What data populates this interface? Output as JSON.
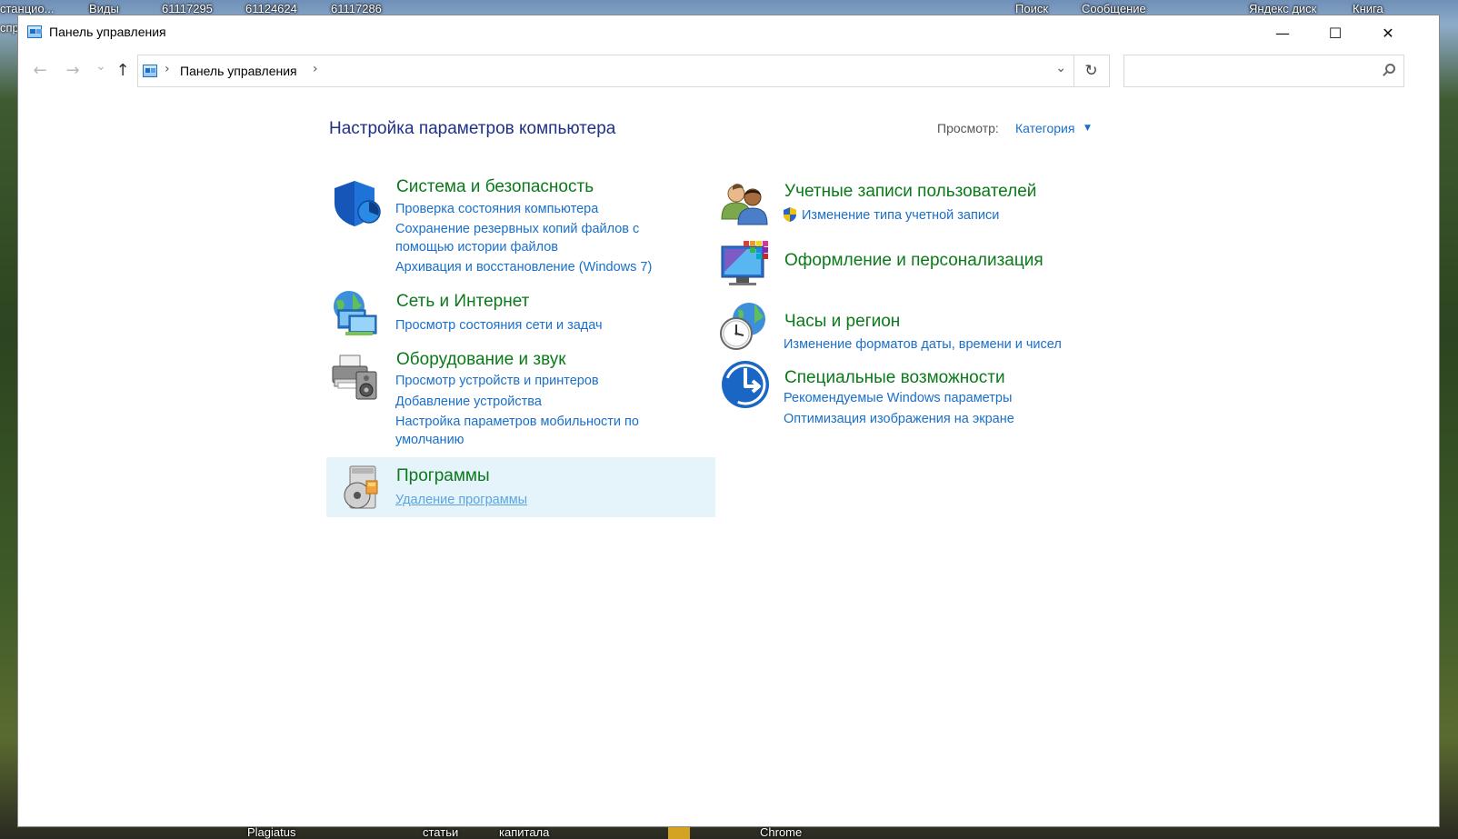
{
  "desktop": {
    "labels_top": [
      "станцио...",
      "Виды",
      "61117295",
      "61124624",
      "61117286",
      "Поиск",
      "Сообщение",
      "Яндекс диск",
      "Книга"
    ],
    "labels_left": [
      "спр"
    ],
    "labels_bottom": [
      "Plagiatus",
      "статьи",
      "капитала",
      "Chrome"
    ]
  },
  "window": {
    "title": "Панель управления",
    "controls": {
      "minimize": "—",
      "maximize": "☐",
      "close": "✕"
    }
  },
  "navbar": {
    "back": "←",
    "forward": "→",
    "recent": "⌄",
    "up": "↑",
    "sep": "›",
    "address": "Панель управления",
    "dropdown": "⌄",
    "refresh": "↻",
    "search_placeholder": ""
  },
  "content": {
    "page_title": "Настройка параметров компьютера",
    "view_label": "Просмотр:",
    "view_value": "Категория",
    "view_caret": "▼",
    "left_categories": [
      {
        "title": "Система и безопасность",
        "links": [
          "Проверка состояния компьютера",
          "Сохранение резервных копий файлов с помощью истории файлов",
          "Архивация и восстановление (Windows 7)"
        ]
      },
      {
        "title": "Сеть и Интернет",
        "links": [
          "Просмотр состояния сети и задач"
        ]
      },
      {
        "title": "Оборудование и звук",
        "links": [
          "Просмотр устройств и принтеров",
          "Добавление устройства",
          "Настройка параметров мобильности по умолчанию"
        ]
      },
      {
        "title": "Программы",
        "links": [
          "Удаление программы"
        ]
      }
    ],
    "right_categories": [
      {
        "title": "Учетные записи пользователей",
        "links": [
          "Изменение типа учетной записи"
        ]
      },
      {
        "title": "Оформление и персонализация",
        "links": []
      },
      {
        "title": "Часы и регион",
        "links": [
          "Изменение форматов даты, времени и чисел"
        ]
      },
      {
        "title": "Специальные возможности",
        "links": [
          "Рекомендуемые Windows параметры",
          "Оптимизация изображения на экране"
        ]
      }
    ]
  }
}
